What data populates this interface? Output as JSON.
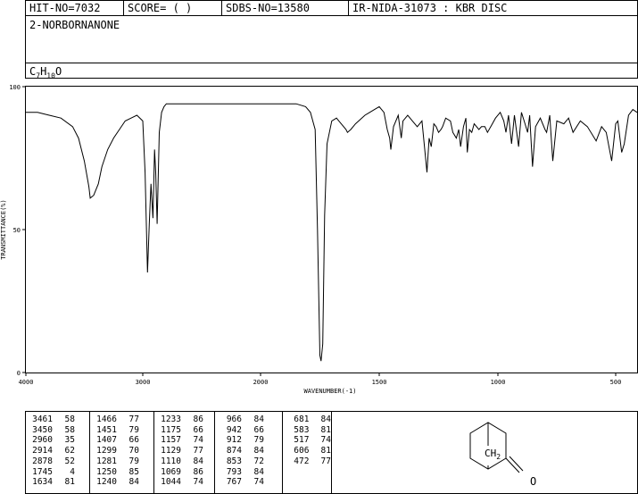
{
  "header": {
    "hit_no": "HIT-NO=7032",
    "score": "SCORE=  (   )",
    "sdbs_no": "SDBS-NO=13580",
    "ir_info": "IR-NIDA-31073 : KBR DISC"
  },
  "compound": {
    "name": "2-NORBORNANONE",
    "formula_c": "C",
    "formula_c_sub": "7",
    "formula_h": "H",
    "formula_h_sub": "10",
    "formula_o": "O"
  },
  "structure": {
    "ch2_label": "CH",
    "ch2_sub": "2",
    "o_label": "O"
  },
  "chart_data": {
    "type": "line",
    "xlabel": "WAVENUMBER(-1)",
    "ylabel": "TRANSMITTANCE(%)",
    "xlim": [
      4000,
      400
    ],
    "ylim": [
      0,
      100
    ],
    "x_ticks": [
      4000,
      3000,
      2000,
      1500,
      1000,
      500
    ],
    "x_tick_labels": [
      "4000",
      "3000",
      "2000",
      "1500",
      "1000",
      "500"
    ],
    "y_ticks": [
      0,
      50,
      100
    ],
    "y_tick_labels": [
      "0",
      "50",
      "100"
    ],
    "series": [
      {
        "x": [
          4000,
          3900,
          3800,
          3700,
          3600,
          3550,
          3500,
          3461,
          3450,
          3420,
          3380,
          3350,
          3300,
          3250,
          3200,
          3150,
          3100,
          3050,
          3000,
          2980,
          2960,
          2945,
          2930,
          2914,
          2900,
          2890,
          2878,
          2860,
          2840,
          2820,
          2800,
          2700,
          2600,
          2400,
          2200,
          2000,
          1900,
          1850,
          1810,
          1790,
          1770,
          1760,
          1750,
          1745,
          1738,
          1730,
          1720,
          1700,
          1680,
          1660,
          1640,
          1634,
          1620,
          1600,
          1560,
          1520,
          1500,
          1480,
          1466,
          1456,
          1451,
          1440,
          1420,
          1407,
          1400,
          1380,
          1360,
          1340,
          1320,
          1299,
          1290,
          1281,
          1270,
          1260,
          1250,
          1240,
          1233,
          1220,
          1200,
          1190,
          1175,
          1165,
          1157,
          1145,
          1135,
          1129,
          1120,
          1110,
          1100,
          1080,
          1069,
          1055,
          1044,
          1030,
          1010,
          990,
          975,
          966,
          955,
          942,
          930,
          912,
          900,
          885,
          874,
          865,
          853,
          840,
          820,
          800,
          793,
          780,
          767,
          750,
          720,
          700,
          681,
          650,
          620,
          583,
          560,
          540,
          517,
          500,
          490,
          472,
          460,
          440,
          420,
          400
        ],
        "values": [
          91,
          91,
          90,
          89,
          86,
          82,
          74,
          65,
          61,
          62,
          66,
          72,
          78,
          82,
          85,
          88,
          89,
          90,
          88,
          70,
          35,
          52,
          66,
          54,
          78,
          70,
          52,
          84,
          91,
          93,
          94,
          94,
          94,
          94,
          94,
          94,
          94,
          94,
          93,
          91,
          85,
          50,
          6,
          4,
          10,
          55,
          80,
          88,
          89,
          87,
          85,
          84,
          85,
          87,
          90,
          92,
          93,
          91,
          85,
          82,
          78,
          86,
          90,
          82,
          88,
          90,
          88,
          86,
          88,
          70,
          82,
          79,
          87,
          86,
          84,
          85,
          86,
          89,
          88,
          84,
          82,
          85,
          79,
          86,
          89,
          77,
          85,
          84,
          87,
          85,
          86,
          86,
          84,
          86,
          89,
          91,
          88,
          84,
          90,
          80,
          90,
          79,
          91,
          87,
          84,
          90,
          72,
          86,
          89,
          85,
          84,
          90,
          74,
          88,
          87,
          89,
          84,
          88,
          86,
          81,
          86,
          84,
          74,
          87,
          88,
          77,
          80,
          90,
          92,
          91
        ]
      }
    ]
  },
  "peaks": [
    [
      [
        "3461",
        "58"
      ],
      [
        "3450",
        "58"
      ],
      [
        "2960",
        "35"
      ],
      [
        "2914",
        "62"
      ],
      [
        "2878",
        "52"
      ],
      [
        "1745",
        "4"
      ],
      [
        "1634",
        "81"
      ]
    ],
    [
      [
        "1466",
        "77"
      ],
      [
        "1451",
        "79"
      ],
      [
        "1407",
        "66"
      ],
      [
        "1299",
        "70"
      ],
      [
        "1281",
        "79"
      ],
      [
        "1250",
        "85"
      ],
      [
        "1240",
        "84"
      ]
    ],
    [
      [
        "1233",
        "86"
      ],
      [
        "1175",
        "66"
      ],
      [
        "1157",
        "74"
      ],
      [
        "1129",
        "77"
      ],
      [
        "1110",
        "84"
      ],
      [
        "1069",
        "86"
      ],
      [
        "1044",
        "74"
      ]
    ],
    [
      [
        "966",
        "84"
      ],
      [
        "942",
        "66"
      ],
      [
        "912",
        "79"
      ],
      [
        "874",
        "84"
      ],
      [
        "853",
        "72"
      ],
      [
        "793",
        "84"
      ],
      [
        "767",
        "74"
      ]
    ],
    [
      [
        "681",
        "84"
      ],
      [
        "583",
        "81"
      ],
      [
        "517",
        "74"
      ],
      [
        "606",
        "81"
      ],
      [
        "472",
        "77"
      ]
    ]
  ]
}
